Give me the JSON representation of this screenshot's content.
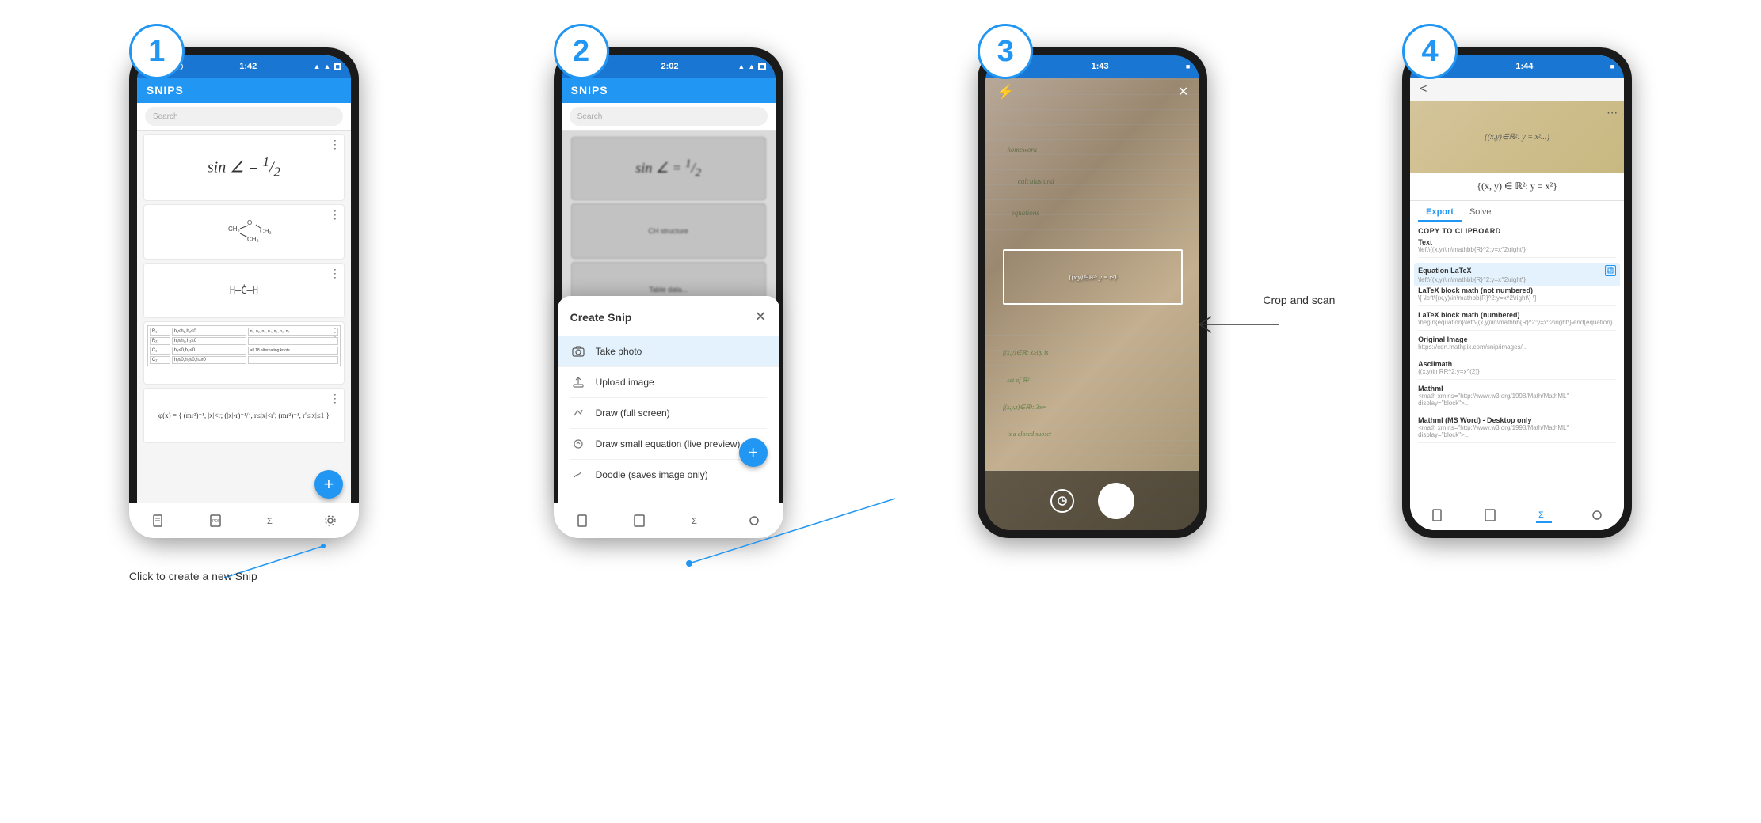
{
  "steps": [
    {
      "number": "1",
      "time": "1:42",
      "screen_title": "SNIPS",
      "annotation": "Click to create a new Snip",
      "snips": [
        {
          "type": "math",
          "content": "sin ∠ = ½"
        },
        {
          "type": "chem",
          "content": "Chemical structure"
        },
        {
          "type": "chem2",
          "content": "H—C—H structure"
        },
        {
          "type": "table",
          "content": "Table data"
        },
        {
          "type": "formula",
          "content": "piecewise function"
        }
      ]
    },
    {
      "number": "2",
      "time": "2:02",
      "screen_title": "SNIPS",
      "dialog_title": "Create Snip",
      "dialog_items": [
        {
          "label": "Take photo",
          "icon": "camera"
        },
        {
          "label": "Upload image",
          "icon": "upload"
        },
        {
          "label": "Draw (full screen)",
          "icon": "draw"
        },
        {
          "label": "Draw small equation (live preview)",
          "icon": "draw2"
        },
        {
          "label": "Doodle (saves image only)",
          "icon": "doodle"
        }
      ]
    },
    {
      "number": "3",
      "time": "1:43",
      "crop_annotation": "Crop and\nscan"
    },
    {
      "number": "4",
      "time": "1:44",
      "back_label": "<",
      "formula_display": "{(x, y) ∈ ℝ²: y = x²}",
      "tabs": [
        "Export",
        "Solve"
      ],
      "active_tab": "Export",
      "section_title": "COPY TO CLIPBOARD",
      "rows": [
        {
          "label": "Text",
          "value": "\\left\\{(x,y)\\in\\mathbb{R}^2:y=x^2\\right\\}"
        },
        {
          "label": "Equation LaTeX",
          "value": "\\left\\{(x,y)\\in\\mathbb{R}^2:y=x^2\\right\\}",
          "highlighted": true
        },
        {
          "label": "LaTeX block math (not numbered)",
          "value": "\\[ \\left\\{(x,y)\\in\\mathbb{R}^2:y=x^2\\right\\} \\]"
        },
        {
          "label": "LaTeX block math (numbered)",
          "value": "\\begin{equation}\\left\\{(x,y)\\in\\mathbb{R}^2:y=x^2\\right\\}\\end{equation}"
        },
        {
          "label": "Original Image",
          "value": "https://cdn.mathpix.com/snip/images/..."
        },
        {
          "label": "Asciimath",
          "value": "{(x,y)in RR^2:y=x^(2)}"
        },
        {
          "label": "Mathml",
          "value": "<math xmlns=\"http://www.w3.org/1998/Math/MathML\" display=\"block\">..."
        },
        {
          "label": "Mathml (MS Word) - Desktop only",
          "value": "<math xmlns=\"http://www.w3.org/1998/Math/MathML\" display=\"block\">..."
        }
      ]
    }
  ],
  "icons": {
    "menu_dots": "⋮",
    "plus": "+",
    "close": "✕",
    "back": "<",
    "flash": "⚡",
    "camera_icon": "📷",
    "upload_icon": "↑",
    "draw_icon": "✏",
    "doc_icon": "📄",
    "copy_icon": "⧉"
  }
}
